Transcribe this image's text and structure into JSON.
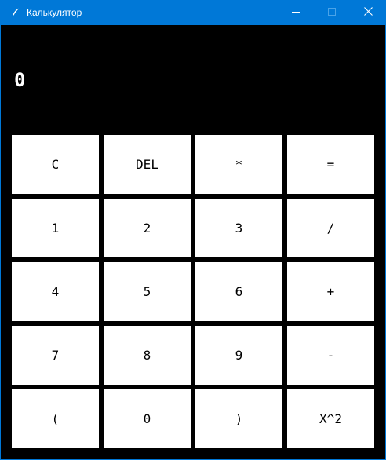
{
  "window": {
    "title": "Калькулятор",
    "title_bar_color": "#0078d7"
  },
  "display": {
    "value": "0"
  },
  "keypad": {
    "keys": [
      {
        "label": "C",
        "name": "clear-button"
      },
      {
        "label": "DEL",
        "name": "delete-button"
      },
      {
        "label": "*",
        "name": "multiply-button"
      },
      {
        "label": "=",
        "name": "equals-button"
      },
      {
        "label": "1",
        "name": "digit-1-button"
      },
      {
        "label": "2",
        "name": "digit-2-button"
      },
      {
        "label": "3",
        "name": "digit-3-button"
      },
      {
        "label": "/",
        "name": "divide-button"
      },
      {
        "label": "4",
        "name": "digit-4-button"
      },
      {
        "label": "5",
        "name": "digit-5-button"
      },
      {
        "label": "6",
        "name": "digit-6-button"
      },
      {
        "label": "+",
        "name": "add-button"
      },
      {
        "label": "7",
        "name": "digit-7-button"
      },
      {
        "label": "8",
        "name": "digit-8-button"
      },
      {
        "label": "9",
        "name": "digit-9-button"
      },
      {
        "label": "-",
        "name": "subtract-button"
      },
      {
        "label": "(",
        "name": "open-paren-button"
      },
      {
        "label": "0",
        "name": "digit-0-button"
      },
      {
        "label": ")",
        "name": "close-paren-button"
      },
      {
        "label": "X^2",
        "name": "square-button"
      }
    ]
  },
  "icons": {
    "app": "feather-icon",
    "minimize": "minimize-icon",
    "maximize": "maximize-icon",
    "close": "close-icon"
  }
}
